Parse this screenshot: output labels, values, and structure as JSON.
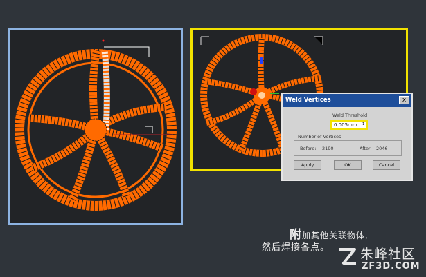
{
  "dialog": {
    "title": "Weld Vertices",
    "close_glyph": "x",
    "threshold_label": "Weld Threshold",
    "threshold_value": "0.005mm",
    "spinner_glyph": "↕",
    "count_group_label": "Number of Vertices",
    "before_label": "Before:",
    "before_value": "2190",
    "after_label": "After:",
    "after_value": "2046",
    "apply_label": "Apply",
    "ok_label": "OK",
    "cancel_label": "Cancel"
  },
  "caption": {
    "line1_lead": "附",
    "line1_rest": "加其他关联物体,",
    "line2": "然后焊接各点。"
  },
  "watermark": {
    "brand_cn": "朱峰社区",
    "brand_en": "ZF3D.COM"
  },
  "colors": {
    "background": "#2f343a",
    "viewport_bg": "#222427",
    "wheel_orange": "#ff6a00",
    "left_active_border": "#8db3e2",
    "right_active_border": "#f2e200",
    "dialog_title": "#1e4e9a"
  },
  "icons": [
    "close-icon",
    "spinner-icon",
    "logo-mark-icon"
  ]
}
